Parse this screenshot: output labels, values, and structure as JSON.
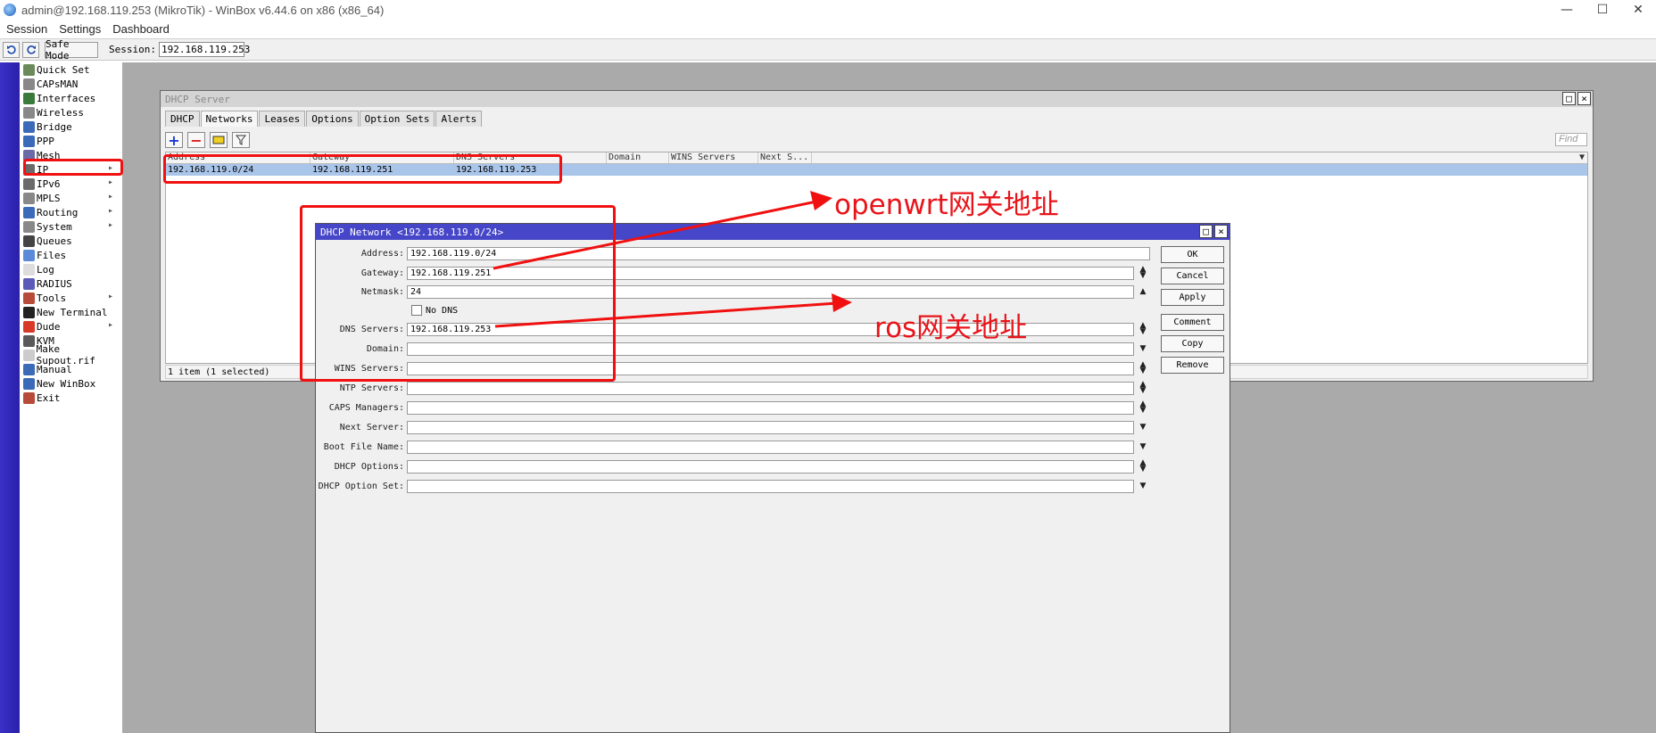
{
  "window": {
    "title": "admin@192.168.119.253 (MikroTik) - WinBox v6.44.6 on x86 (x86_64)",
    "controls": [
      "—",
      "☐",
      "✕"
    ]
  },
  "menu": [
    "Session",
    "Settings",
    "Dashboard"
  ],
  "toolbar": {
    "undo_icon": "undo-icon",
    "redo_icon": "redo-icon",
    "safe_mode": "Safe Mode",
    "session_label": "Session:",
    "session_value": "192.168.119.253"
  },
  "sidebar": {
    "items": [
      {
        "label": "Quick Set",
        "icon": "quick-set-icon",
        "color": "#6a8a5a"
      },
      {
        "label": "CAPsMAN",
        "icon": "capsman-icon",
        "color": "#888888"
      },
      {
        "label": "Interfaces",
        "icon": "interfaces-icon",
        "color": "#3a7a3a"
      },
      {
        "label": "Wireless",
        "icon": "wireless-icon",
        "color": "#888888"
      },
      {
        "label": "Bridge",
        "icon": "bridge-icon",
        "color": "#3a6ab8"
      },
      {
        "label": "PPP",
        "icon": "ppp-icon",
        "color": "#3a6ab8"
      },
      {
        "label": "Mesh",
        "icon": "mesh-icon",
        "color": "#6a6aa8"
      },
      {
        "label": "IP",
        "icon": "ip-icon",
        "color": "#6a6a6a",
        "submenu": true
      },
      {
        "label": "IPv6",
        "icon": "ipv6-icon",
        "color": "#6a6a6a",
        "submenu": true
      },
      {
        "label": "MPLS",
        "icon": "mpls-icon",
        "color": "#888888",
        "submenu": true
      },
      {
        "label": "Routing",
        "icon": "routing-icon",
        "color": "#3a6ab8",
        "submenu": true
      },
      {
        "label": "System",
        "icon": "system-icon",
        "color": "#888888",
        "submenu": true
      },
      {
        "label": "Queues",
        "icon": "queues-icon",
        "color": "#444444"
      },
      {
        "label": "Files",
        "icon": "files-icon",
        "color": "#5a8ad8"
      },
      {
        "label": "Log",
        "icon": "log-icon",
        "color": "#dddddd"
      },
      {
        "label": "RADIUS",
        "icon": "radius-icon",
        "color": "#5a5ab8"
      },
      {
        "label": "Tools",
        "icon": "tools-icon",
        "color": "#b84a3a",
        "submenu": true
      },
      {
        "label": "New Terminal",
        "icon": "terminal-icon",
        "color": "#222222"
      },
      {
        "label": "Dude",
        "icon": "dude-icon",
        "color": "#d83a2a",
        "submenu": true
      },
      {
        "label": "KVM",
        "icon": "kvm-icon",
        "color": "#5a5a5a"
      },
      {
        "label": "Make Supout.rif",
        "icon": "supout-icon",
        "color": "#cccccc"
      },
      {
        "label": "Manual",
        "icon": "manual-icon",
        "color": "#3a6ab8"
      },
      {
        "label": "New WinBox",
        "icon": "winbox-icon",
        "color": "#3a6ab8"
      },
      {
        "label": "Exit",
        "icon": "exit-icon",
        "color": "#b84a3a"
      }
    ]
  },
  "dhcp_server": {
    "title": "DHCP Server",
    "tabs": [
      "DHCP",
      "Networks",
      "Leases",
      "Options",
      "Option Sets",
      "Alerts"
    ],
    "active_tab": "Networks",
    "find_placeholder": "Find",
    "columns": [
      "Address",
      "Gateway",
      "DNS Servers",
      "Domain",
      "WINS Servers",
      "Next S..."
    ],
    "rows": [
      [
        "192.168.119.0/24",
        "192.168.119.251",
        "192.168.119.253",
        "",
        "",
        ""
      ]
    ],
    "status": "1 item (1 selected)"
  },
  "dhcp_network": {
    "title": "DHCP Network <192.168.119.0/24>",
    "fields": {
      "address": {
        "label": "Address:",
        "value": "192.168.119.0/24"
      },
      "gateway": {
        "label": "Gateway:",
        "value": "192.168.119.251"
      },
      "netmask": {
        "label": "Netmask:",
        "value": "24"
      },
      "no_dns": {
        "label": "No DNS"
      },
      "dns_servers": {
        "label": "DNS Servers:",
        "value": "192.168.119.253"
      },
      "domain": {
        "label": "Domain:",
        "value": ""
      },
      "wins_servers": {
        "label": "WINS Servers:",
        "value": ""
      },
      "ntp_servers": {
        "label": "NTP Servers:",
        "value": ""
      },
      "caps_managers": {
        "label": "CAPS Managers:",
        "value": ""
      },
      "next_server": {
        "label": "Next Server:",
        "value": ""
      },
      "boot_file_name": {
        "label": "Boot File Name:",
        "value": ""
      },
      "dhcp_options": {
        "label": "DHCP Options:",
        "value": ""
      },
      "dhcp_option_set": {
        "label": "DHCP Option Set:",
        "value": ""
      }
    },
    "buttons": {
      "ok": "OK",
      "cancel": "Cancel",
      "apply": "Apply",
      "comment": "Comment",
      "copy": "Copy",
      "remove": "Remove"
    }
  },
  "annotations": {
    "openwrt": "openwrt网关地址",
    "ros": "ros网关地址",
    "color": "#f01010"
  }
}
